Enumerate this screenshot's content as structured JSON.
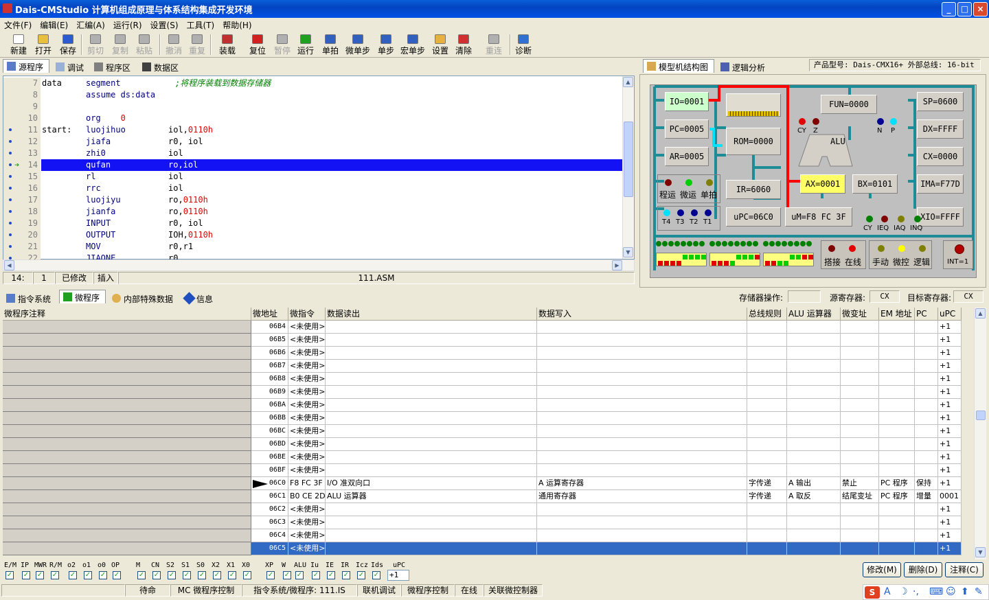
{
  "window": {
    "title": "Dais-CMStudio 计算机组成原理与体系结构集成开发环境",
    "min": "_",
    "max": "□",
    "close": "×"
  },
  "menu": [
    "文件(F)",
    "编辑(E)",
    "汇编(A)",
    "运行(R)",
    "设置(S)",
    "工具(T)",
    "帮助(H)"
  ],
  "toolbar": [
    {
      "label": "新建",
      "enabled": true,
      "icon": "new-file-icon",
      "color": "#ffffff"
    },
    {
      "label": "打开",
      "enabled": true,
      "icon": "open-folder-icon",
      "color": "#e8c040"
    },
    {
      "label": "保存",
      "enabled": true,
      "icon": "save-disk-icon",
      "color": "#2c5ad0"
    },
    {
      "label": "剪切",
      "enabled": false,
      "icon": "cut-icon",
      "color": "#b0b0b0"
    },
    {
      "label": "复制",
      "enabled": false,
      "icon": "copy-icon",
      "color": "#b0b0b0"
    },
    {
      "label": "粘贴",
      "enabled": false,
      "icon": "paste-icon",
      "color": "#b0b0b0"
    },
    {
      "label": "撤消",
      "enabled": false,
      "icon": "undo-icon",
      "color": "#b0b0b0"
    },
    {
      "label": "重复",
      "enabled": false,
      "icon": "redo-icon",
      "color": "#b0b0b0"
    },
    {
      "label": "装载",
      "enabled": true,
      "icon": "load-icon",
      "color": "#c03030"
    },
    {
      "label": "复位",
      "enabled": true,
      "icon": "reset-icon",
      "color": "#d02020"
    },
    {
      "label": "暂停",
      "enabled": false,
      "icon": "pause-icon",
      "color": "#b0b0b0"
    },
    {
      "label": "运行",
      "enabled": true,
      "icon": "run-icon",
      "color": "#20a020"
    },
    {
      "label": "单拍",
      "enabled": true,
      "icon": "single-beat-icon",
      "color": "#3060c0"
    },
    {
      "label": "微单步",
      "enabled": true,
      "icon": "micro-step-icon",
      "color": "#3060c0"
    },
    {
      "label": "单步",
      "enabled": true,
      "icon": "step-icon",
      "color": "#3060c0"
    },
    {
      "label": "宏单步",
      "enabled": true,
      "icon": "macro-step-icon",
      "color": "#3060c0"
    },
    {
      "label": "设置",
      "enabled": true,
      "icon": "hand-settings-icon",
      "color": "#e8b040"
    },
    {
      "label": "清除",
      "enabled": true,
      "icon": "clear-icon",
      "color": "#d03030"
    },
    {
      "label": "重连",
      "enabled": false,
      "icon": "reconnect-icon",
      "color": "#b0b0b0"
    },
    {
      "label": "诊断",
      "enabled": true,
      "icon": "diagnose-icon",
      "color": "#3070d0"
    }
  ],
  "left_tabs": [
    {
      "label": "源程序",
      "icon": "source-icon"
    },
    {
      "label": "调试",
      "icon": "debug-icon"
    },
    {
      "label": "程序区",
      "icon": "program-area-icon"
    },
    {
      "label": "数据区",
      "icon": "data-area-icon"
    }
  ],
  "right_tabs": [
    {
      "label": "模型机结构图",
      "icon": "model-icon"
    },
    {
      "label": "逻辑分析",
      "icon": "logic-analyzer-icon"
    }
  ],
  "product": "产品型号: Dais-CMX16+  外部总线: 16-bit",
  "code": [
    {
      "n": "7",
      "a": "data",
      "b": "segment",
      "c": "",
      "cm": ";将程序装载到数据存储器",
      "bp": false
    },
    {
      "n": "8",
      "a": "",
      "b": "assume ds:data",
      "c": "",
      "cm": "",
      "bp": false
    },
    {
      "n": "9",
      "a": "",
      "b": "",
      "c": "",
      "cm": "",
      "bp": false
    },
    {
      "n": "10",
      "a": "",
      "b": "org    0",
      "c": "",
      "cm": "",
      "bp": false,
      "orgnum": true
    },
    {
      "n": "11",
      "a": "start:",
      "b": "luojihuo",
      "c": "iol,",
      "num": "0110h",
      "bp": true
    },
    {
      "n": "12",
      "a": "",
      "b": "jiafa",
      "c": "r0, iol",
      "bp": true
    },
    {
      "n": "13",
      "a": "",
      "b": "zhi0",
      "c": "iol",
      "bp": true
    },
    {
      "n": "14",
      "a": "",
      "b": "qufan",
      "c": "ro,iol",
      "bp": true,
      "sel": true
    },
    {
      "n": "15",
      "a": "",
      "b": "rl",
      "c": "iol",
      "bp": true
    },
    {
      "n": "16",
      "a": "",
      "b": "rrc",
      "c": "iol",
      "bp": true
    },
    {
      "n": "17",
      "a": "",
      "b": "luojiyu",
      "c": "ro,",
      "num": "0110h",
      "bp": true
    },
    {
      "n": "18",
      "a": "",
      "b": "jianfa",
      "c": "ro,",
      "num": "0110h",
      "bp": true
    },
    {
      "n": "19",
      "a": "",
      "b": "INPUT",
      "c": "r0, iol",
      "bp": true
    },
    {
      "n": "20",
      "a": "",
      "b": "OUTPUT",
      "c": "IOH,",
      "num": "0110h",
      "bp": true
    },
    {
      "n": "21",
      "a": "",
      "b": "MOV",
      "c": "r0,r1",
      "bp": true
    },
    {
      "n": "22",
      "a": "",
      "b": "JIAONE",
      "c": "r0",
      "bp": true
    }
  ],
  "editor_status": {
    "line": "14:",
    "col": "1",
    "modified": "已修改",
    "mode": "插入",
    "file": "111.ASM"
  },
  "model": {
    "IO": "IO=0001",
    "PC": "PC=0005",
    "AR": "AR=0005",
    "ROM": "ROM=0000",
    "FUN": "FUN=0000",
    "ALU": "ALU",
    "SP": "SP=0600",
    "DX": "DX=FFFF",
    "CX": "CX=0000",
    "IMA": "IMA=F77D",
    "AX": "AX=0001",
    "BX": "BX=0101",
    "IR": "IR=6060",
    "UPC": "uPC=06C0",
    "UM": "uM=F8  FC  3F",
    "XIO": "XIO=FFFF",
    "flags": [
      "CY",
      "Z",
      "N",
      "P"
    ],
    "ctrl": [
      "程运",
      "微运",
      "单拍"
    ],
    "timing": [
      "T4",
      "T3",
      "T2",
      "T1"
    ],
    "irq": [
      "CY",
      "IEQ",
      "IAQ",
      "INQ"
    ],
    "mode1": [
      "搭接",
      "在线"
    ],
    "mode2": [
      "手动",
      "微控",
      "逻辑"
    ],
    "int": "INT=1"
  },
  "bottom_tabs": [
    {
      "label": "指令系统",
      "icon": "instruction-icon"
    },
    {
      "label": "微程序",
      "icon": "microprogram-icon"
    },
    {
      "label": "内部特殊数据",
      "icon": "magnifier-icon"
    },
    {
      "label": "信息",
      "icon": "info-icon"
    }
  ],
  "mem_op": {
    "label": "存储器操作:",
    "value": ""
  },
  "src_reg": {
    "label": "源寄存器:",
    "value": "CX"
  },
  "dst_reg": {
    "label": "目标寄存器:",
    "value": "CX"
  },
  "table": {
    "headers": [
      "微程序注释",
      "微地址",
      "微指令",
      "数据读出",
      "数据写入",
      "总线规则",
      "ALU 运算器",
      "微变址",
      "EM 地址",
      "PC",
      "uPC"
    ],
    "rows": [
      {
        "addr": "06B4",
        "mi": "<未使用>",
        "rd": "",
        "wr": "",
        "bus": "",
        "alu": "",
        "vx": "",
        "em": "",
        "pc": "",
        "upc": "+1"
      },
      {
        "addr": "06B5",
        "mi": "<未使用>",
        "rd": "",
        "wr": "",
        "bus": "",
        "alu": "",
        "vx": "",
        "em": "",
        "pc": "",
        "upc": "+1"
      },
      {
        "addr": "06B6",
        "mi": "<未使用>",
        "rd": "",
        "wr": "",
        "bus": "",
        "alu": "",
        "vx": "",
        "em": "",
        "pc": "",
        "upc": "+1"
      },
      {
        "addr": "06B7",
        "mi": "<未使用>",
        "rd": "",
        "wr": "",
        "bus": "",
        "alu": "",
        "vx": "",
        "em": "",
        "pc": "",
        "upc": "+1"
      },
      {
        "addr": "06B8",
        "mi": "<未使用>",
        "rd": "",
        "wr": "",
        "bus": "",
        "alu": "",
        "vx": "",
        "em": "",
        "pc": "",
        "upc": "+1"
      },
      {
        "addr": "06B9",
        "mi": "<未使用>",
        "rd": "",
        "wr": "",
        "bus": "",
        "alu": "",
        "vx": "",
        "em": "",
        "pc": "",
        "upc": "+1"
      },
      {
        "addr": "06BA",
        "mi": "<未使用>",
        "rd": "",
        "wr": "",
        "bus": "",
        "alu": "",
        "vx": "",
        "em": "",
        "pc": "",
        "upc": "+1"
      },
      {
        "addr": "06BB",
        "mi": "<未使用>",
        "rd": "",
        "wr": "",
        "bus": "",
        "alu": "",
        "vx": "",
        "em": "",
        "pc": "",
        "upc": "+1"
      },
      {
        "addr": "06BC",
        "mi": "<未使用>",
        "rd": "",
        "wr": "",
        "bus": "",
        "alu": "",
        "vx": "",
        "em": "",
        "pc": "",
        "upc": "+1"
      },
      {
        "addr": "06BD",
        "mi": "<未使用>",
        "rd": "",
        "wr": "",
        "bus": "",
        "alu": "",
        "vx": "",
        "em": "",
        "pc": "",
        "upc": "+1"
      },
      {
        "addr": "06BE",
        "mi": "<未使用>",
        "rd": "",
        "wr": "",
        "bus": "",
        "alu": "",
        "vx": "",
        "em": "",
        "pc": "",
        "upc": "+1"
      },
      {
        "addr": "06BF",
        "mi": "<未使用>",
        "rd": "",
        "wr": "",
        "bus": "",
        "alu": "",
        "vx": "",
        "em": "",
        "pc": "",
        "upc": "+1"
      },
      {
        "addr": "06C0",
        "mi": "F8 FC 3F",
        "rd": "I/O 准双向口",
        "wr": "A 运算寄存器",
        "bus": "字传递",
        "alu": "A 输出",
        "vx": "禁止",
        "em": "PC 程序",
        "pc": "保持",
        "upc": "+1",
        "cur": true
      },
      {
        "addr": "06C1",
        "mi": "B0 CE 2D",
        "rd": "ALU 运算器",
        "wr": "通用寄存器",
        "bus": "字传递",
        "alu": "A 取反",
        "vx": "结尾变址",
        "em": "PC 程序",
        "pc": "增量",
        "upc": "0001"
      },
      {
        "addr": "06C2",
        "mi": "<未使用>",
        "rd": "",
        "wr": "",
        "bus": "",
        "alu": "",
        "vx": "",
        "em": "",
        "pc": "",
        "upc": "+1"
      },
      {
        "addr": "06C3",
        "mi": "<未使用>",
        "rd": "",
        "wr": "",
        "bus": "",
        "alu": "",
        "vx": "",
        "em": "",
        "pc": "",
        "upc": "+1"
      },
      {
        "addr": "06C4",
        "mi": "<未使用>",
        "rd": "",
        "wr": "",
        "bus": "",
        "alu": "",
        "vx": "",
        "em": "",
        "pc": "",
        "upc": "+1"
      },
      {
        "addr": "06C5",
        "mi": "<未使用>",
        "rd": "",
        "wr": "",
        "bus": "",
        "alu": "",
        "vx": "",
        "em": "",
        "pc": "",
        "upc": "+1",
        "sel": true
      }
    ]
  },
  "bits": [
    "E/M",
    "IP",
    "MWR",
    "R/M",
    "o2",
    "o1",
    "o0",
    "OP",
    "M",
    "CN",
    "S2",
    "S1",
    "S0",
    "X2",
    "X1",
    "X0",
    "XP",
    "W",
    "ALU",
    "Iu",
    "IE",
    "IR",
    "Icz",
    "Ids",
    "uPC"
  ],
  "upc_value": "+1",
  "buttons": {
    "modify": "修改(M)",
    "delete": "删除(D)",
    "comment": "注释(C)"
  },
  "status": [
    "待命",
    "MC 微程序控制",
    "指令系统/微程序: 111.IS",
    "联机调试",
    "微程序控制",
    "在线",
    "关联微控制器"
  ]
}
